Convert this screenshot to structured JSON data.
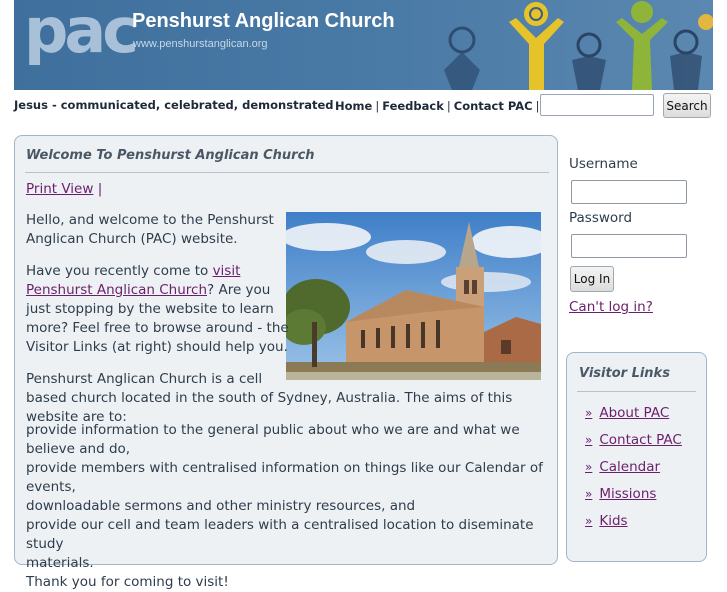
{
  "banner": {
    "logo_text": "pac",
    "title": "Penshurst Anglican Church",
    "url": "www.penshurstanglican.org"
  },
  "tagline": "Jesus - communicated, celebrated, demonstrated",
  "topnav": {
    "home": "Home",
    "feedback": "Feedback",
    "contact": "Contact PAC",
    "separator": "|"
  },
  "search": {
    "value": "",
    "button_label": "Search"
  },
  "main": {
    "title": "Welcome To Penshurst Anglican Church",
    "print_view": "Print View",
    "print_sep": "|",
    "para1_line1": "Hello, and welcome to the Penshurst",
    "para1_line2": "Anglican Church (PAC) website.",
    "para2_pre": "Have you recently come to ",
    "para2_link_a": "visit",
    "para2_link_b": "Penshurst Anglican Church",
    "para2_post_b": "? Are you",
    "para2_line3": "just stopping by the website to learn",
    "para2_line4": "more? Feel free to browse around - the",
    "para2_line5": "Visitor Links (at right) should help you.",
    "para3_line1": "Penshurst Anglican Church is a cell",
    "para3_line2": "based church located in the south of Sydney, Australia. The aims of this website are to:",
    "aims_line1": "provide information to the general public about who we are and what we believe and do,",
    "aims_line2": "provide members with centralised information on things like our Calendar of events,",
    "aims_line3": "downloadable sermons and other ministry resources, and",
    "aims_line4": "provide our cell and team leaders with a centralised location to diseminate study",
    "aims_line5": "materials.",
    "thanks": "Thank you for coming to visit!"
  },
  "login": {
    "username_label": "Username",
    "username_value": "",
    "password_label": "Password",
    "password_value": "",
    "button_label": "Log In",
    "cant_login": "Can't log in?"
  },
  "visitor_links": {
    "title": "Visitor Links",
    "bullet": "»",
    "items": [
      "About PAC",
      "Contact PAC",
      "Calendar",
      "Missions",
      "Kids"
    ]
  },
  "colors": {
    "banner": "#4a7aa6",
    "link": "#6b1f6b",
    "panel": "#eef1f4",
    "panel_border": "#9fb6cd"
  }
}
